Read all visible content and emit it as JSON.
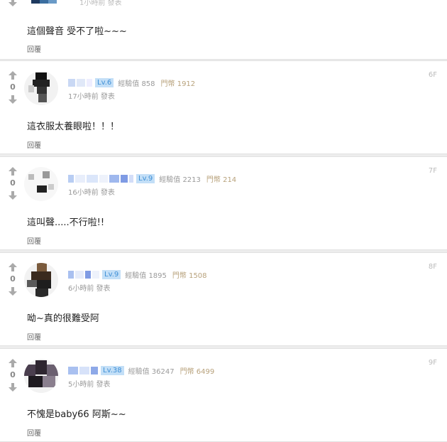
{
  "top": {
    "time": "1小時前 發表",
    "comment": "這個聲音 受不了啦~~~",
    "reply": "回覆"
  },
  "comments": [
    {
      "floor": "6F",
      "score": "0",
      "level": "Lv.6",
      "exp": "經驗值 858",
      "coins": "門幣 1912",
      "time": "17小時前 發表",
      "text": "這衣服太養眼啦！！！",
      "reply": "回覆"
    },
    {
      "floor": "7F",
      "score": "0",
      "level": "Lv.9",
      "exp": "經驗值 2213",
      "coins": "門幣 214",
      "time": "16小時前 發表",
      "text": "這叫聲.....不行啦!!",
      "reply": "回覆"
    },
    {
      "floor": "8F",
      "score": "0",
      "level": "Lv.9",
      "exp": "經驗值 1895",
      "coins": "門幣 1508",
      "time": "6小時前 發表",
      "text": "呦~真的很難受阿",
      "reply": "回覆"
    },
    {
      "floor": "9F",
      "score": "0",
      "level": "Lv.38",
      "exp": "經驗值 36247",
      "coins": "門幣 6499",
      "time": "5小時前 發表",
      "text": "不愧是baby66 阿斯~~",
      "reply": "回覆"
    }
  ],
  "colors": {
    "accent": "#3e8fd6",
    "level_bg": "#c3dff7",
    "coins": "#b8a27c",
    "meta": "#9a9a9a"
  },
  "icons": {
    "upvote": "arrow-up-icon",
    "downvote": "arrow-down-icon"
  }
}
